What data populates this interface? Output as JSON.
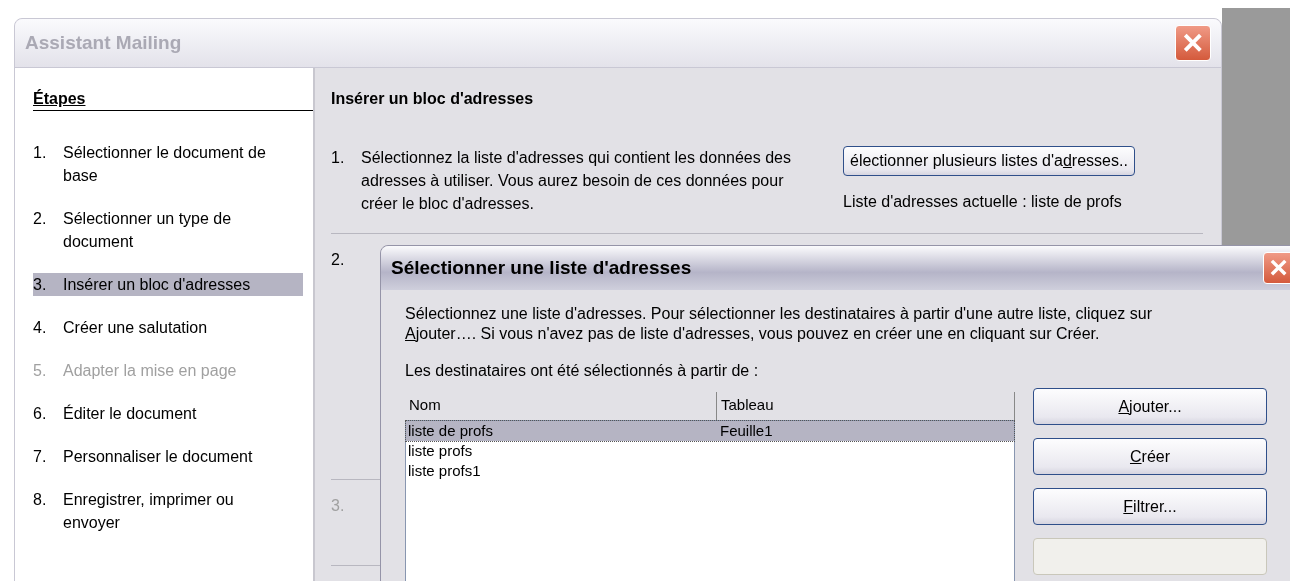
{
  "window": {
    "title": "Assistant Mailing",
    "active": false
  },
  "sidebar": {
    "heading": "Étapes",
    "items": [
      {
        "number": "1.",
        "label": "Sélectionner le document de base",
        "selected": false,
        "disabled": false
      },
      {
        "number": "2.",
        "label": "Sélectionner un type de document",
        "selected": false,
        "disabled": false
      },
      {
        "number": "3.",
        "label": "Insérer un bloc d'adresses",
        "selected": true,
        "disabled": false
      },
      {
        "number": "4.",
        "label": "Créer une salutation",
        "selected": false,
        "disabled": false
      },
      {
        "number": "5.",
        "label": "Adapter la mise en page",
        "selected": false,
        "disabled": true
      },
      {
        "number": "6.",
        "label": "Éditer le document",
        "selected": false,
        "disabled": false
      },
      {
        "number": "7.",
        "label": "Personnaliser le document",
        "selected": false,
        "disabled": false
      },
      {
        "number": "8.",
        "label": "Enregistrer, imprimer ou envoyer",
        "selected": false,
        "disabled": false
      }
    ]
  },
  "content": {
    "heading": "Insérer un bloc d'adresses",
    "step_1": {
      "number": "1.",
      "text": "Sélectionnez la liste d'adresses qui contient les données des adresses à utiliser. Vous aurez besoin de ces données pour créer le bloc d'adresses.",
      "button": {
        "before": "électionner plusieurs listes d'a",
        "accel": "d",
        "after": "resses.."
      },
      "current_list": "Liste d'adresses actuelle : liste de profs"
    },
    "step_2": {
      "number": "2.",
      "disabled": false
    },
    "step_3": {
      "number": "3.",
      "disabled": true
    }
  },
  "dialog": {
    "title": "Sélectionner une liste d'adresses",
    "intro": {
      "before": "Sélectionnez une liste d'adresses. Pour sélectionner les destinataires à partir d'une autre liste, cliquez sur ",
      "accel": "A",
      "after": "jouter…. Si vous n'avez pas de liste d'adresses, vous pouvez en créer une en cliquant sur Créer."
    },
    "source_label": "Les destinataires ont été sélectionnés à partir de :",
    "table": {
      "columns": [
        "Nom",
        "Tableau"
      ],
      "rows": [
        {
          "cells": [
            "liste de profs",
            "Feuille1"
          ],
          "selected": true
        },
        {
          "cells": [
            "liste profs",
            ""
          ],
          "selected": false
        },
        {
          "cells": [
            "liste profs1",
            ""
          ],
          "selected": false
        }
      ]
    },
    "buttons": [
      {
        "accel": "A",
        "after": "jouter...",
        "disabled": false
      },
      {
        "accel": "C",
        "after": "réer",
        "disabled": false
      },
      {
        "accel": "F",
        "after": "iltrer...",
        "disabled": false
      },
      {
        "disabled": true
      }
    ]
  }
}
